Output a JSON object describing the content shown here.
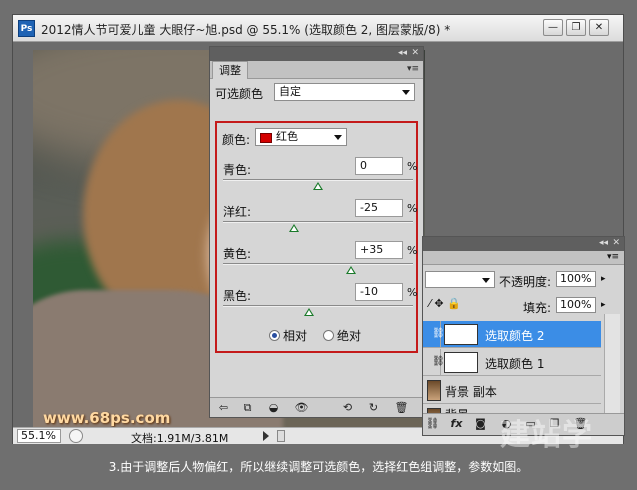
{
  "window": {
    "app_logo": "Ps",
    "title": "2012情人节可爱儿童  大眼仔~旭.psd @ 55.1% (选取颜色 2, 图层蒙版/8) *",
    "minimize": "—",
    "restore": "❐",
    "close": "✕"
  },
  "photo": {
    "watermark": "www.68ps.com"
  },
  "statusbar": {
    "zoom": "55.1%",
    "doc_size": "文档:1.91M/3.81M"
  },
  "adjustments": {
    "tab_label": "调整",
    "preset_label": "可选颜色",
    "preset_value": "自定",
    "colors_label": "颜色:",
    "colors_value": "红色",
    "sliders": [
      {
        "label": "青色:",
        "value": "0",
        "unit": "%",
        "level": 0
      },
      {
        "label": "洋红:",
        "value": "-25",
        "unit": "%",
        "level": -25
      },
      {
        "label": "黄色:",
        "value": "+35",
        "unit": "%",
        "level": 35
      },
      {
        "label": "黑色:",
        "value": "-10",
        "unit": "%",
        "level": -10
      }
    ],
    "method_relative": "相对",
    "method_absolute": "绝对",
    "method_selected": "relative"
  },
  "layers": {
    "opacity_label": "不透明度:",
    "opacity_value": "100%",
    "fill_label": "填充:",
    "fill_value": "100%",
    "rows": [
      {
        "name": "选取颜色 2",
        "selected": true
      },
      {
        "name": "选取颜色 1",
        "selected": false
      },
      {
        "name": "背景 副本",
        "selected": false
      },
      {
        "name": "背景",
        "selected": false
      }
    ]
  },
  "caption": "3.由于调整后人物偏红，所以继续调整可选颜色，选择红色组调整，参数如图。",
  "site_watermark": "建站学",
  "colors": {
    "highlight_red": "#c41a1a",
    "selection_blue": "#3b8de6"
  }
}
